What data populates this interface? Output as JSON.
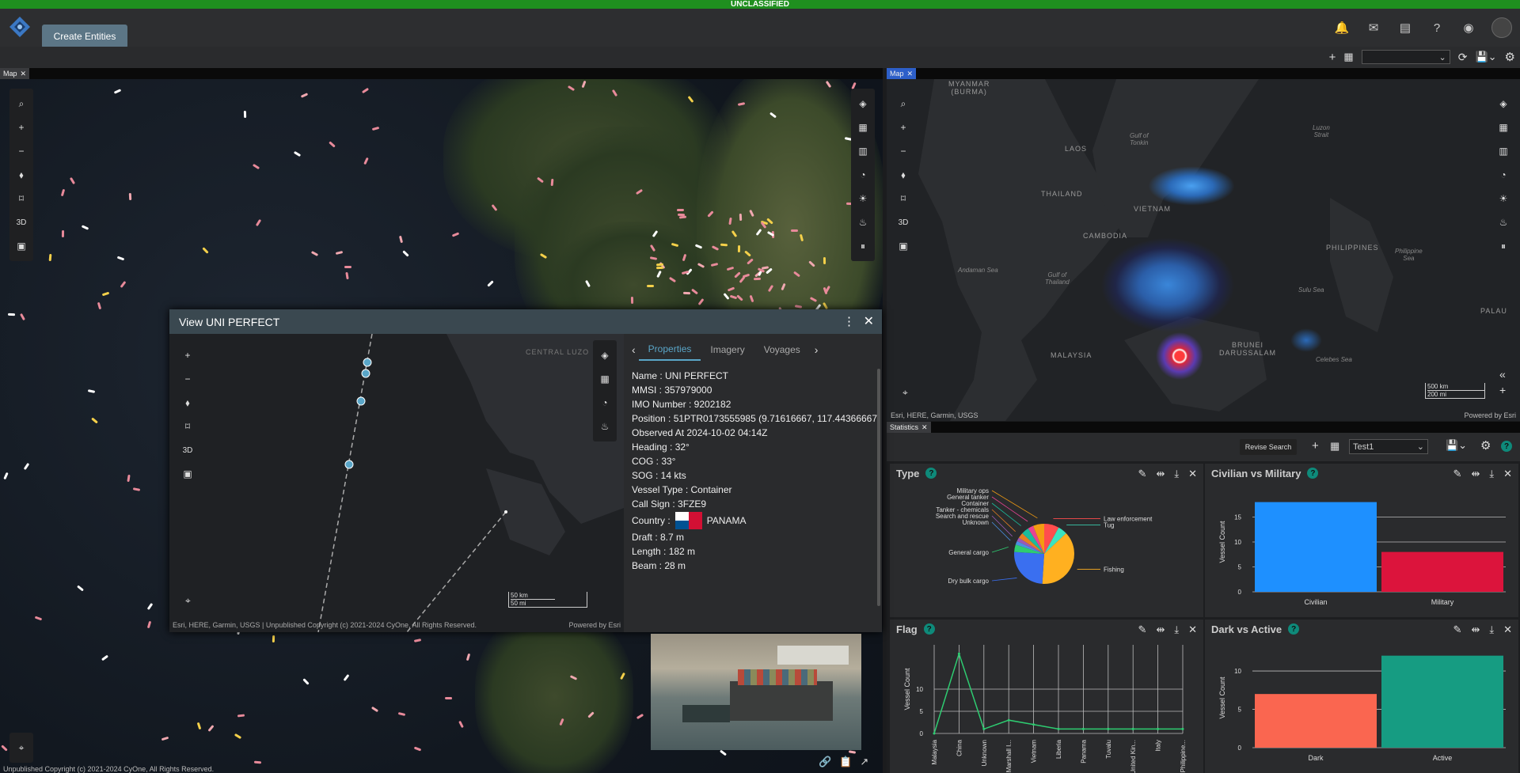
{
  "classification": "UNCLASSIFIED",
  "header": {
    "create_button": "Create Entities"
  },
  "left_map": {
    "tab": "Map",
    "tool_3d": "3D",
    "copyright": "Unpublished Copyright (c) 2021-2024 CyOne, All Rights Reserved."
  },
  "right_map": {
    "tab": "Map",
    "tool_3d": "3D",
    "attribution": "Esri, HERE, Garmin, USGS",
    "powered": "Powered by Esri",
    "scale_km": "500 km",
    "scale_mi": "200 mi",
    "labels": {
      "myanmar": "MYANMAR\n(BURMA)",
      "laos": "LAOS",
      "thailand": "THAILAND",
      "vietnam": "VIETNAM",
      "cambodia": "CAMBODIA",
      "malaysia": "MALAYSIA",
      "brunei": "BRUNEI\nDARUSSALAM",
      "philippines": "PHILIPPINES",
      "palau": "PALAU",
      "andaman": "Andaman Sea",
      "gulf_thailand": "Gulf of\nThailand",
      "gulf_tonkin": "Gulf of\nTonkin",
      "luzon": "Luzon\nStrait",
      "sulu": "Sulu Sea",
      "celebes": "Celebes Sea",
      "phil_sea": "Philippine\nSea"
    }
  },
  "dialog": {
    "title": "View UNI PERFECT",
    "tool_3d": "3D",
    "map_label": "CENTRAL LUZO",
    "scale_km": "50 km",
    "scale_mi": "50 mi",
    "attribution": "Esri, HERE, Garmin, USGS | Unpublished Copyright (c) 2021-2024 CyOne, All Rights Reserved.",
    "powered": "Powered by Esri",
    "tabs": [
      "Properties",
      "Imagery",
      "Voyages"
    ],
    "props": {
      "name": "Name : UNI PERFECT",
      "mmsi": "MMSI : 357979000",
      "imo": "IMO Number : 9202182",
      "position": "Position : 51PTR0173555985 (9.71616667, 117.44366667)",
      "observed": "Observed At 2024-10-02 04:14Z",
      "heading": "Heading : 32°",
      "cog": "COG : 33°",
      "sog": "SOG : 14 kts",
      "vessel_type": "Vessel Type : Container",
      "call_sign": "Call Sign : 3FZE9",
      "country_label": "Country :",
      "country": "PANAMA",
      "draft": "Draft : 8.7 m",
      "length": "Length : 182 m",
      "beam": "Beam : 28 m"
    }
  },
  "statistics": {
    "tab": "Statistics",
    "revise": "Revise Search",
    "preset": "Test1"
  },
  "type_widget": {
    "title": "Type",
    "help": "?"
  },
  "civmil_widget": {
    "title": "Civilian vs Military",
    "help": "?"
  },
  "flag_widget": {
    "title": "Flag",
    "help": "?"
  },
  "dark_widget": {
    "title": "Dark vs Active",
    "help": "?"
  },
  "chart_data": [
    {
      "type": "pie",
      "title": "Type",
      "categories": [
        "Law enforcement",
        "Tug",
        "Fishing",
        "Dry bulk cargo",
        "General cargo",
        "Unknown",
        "Search and rescue",
        "Tanker - chemicals",
        "Container",
        "General tanker",
        "Military ops"
      ],
      "values": [
        8,
        5,
        38,
        25,
        4,
        2,
        2,
        3,
        4,
        3,
        6
      ]
    },
    {
      "type": "bar",
      "title": "Civilian vs Military",
      "categories": [
        "Civilian",
        "Military"
      ],
      "values": [
        18,
        8
      ],
      "ylabel": "Vessel Count",
      "ylim": [
        0,
        20
      ],
      "yticks": [
        0,
        5,
        10,
        15
      ],
      "colors": [
        "#1e90ff",
        "#dc143c"
      ]
    },
    {
      "type": "line",
      "title": "Flag",
      "categories": [
        "Malaysia",
        "China",
        "Unknown",
        "Marshall I...",
        "Vietnam",
        "Liberia",
        "Panama",
        "Tuvalu",
        "United Kin...",
        "Italy",
        "Philippine..."
      ],
      "values": [
        0,
        18,
        1,
        3,
        2,
        1,
        1,
        1,
        1,
        1,
        1
      ],
      "ylabel": "Vessel Count",
      "ylim": [
        0,
        20
      ],
      "yticks": [
        0,
        5,
        10
      ]
    },
    {
      "type": "bar",
      "title": "Dark vs Active",
      "categories": [
        "Dark",
        "Active"
      ],
      "values": [
        7,
        12
      ],
      "ylabel": "Vessel Count",
      "ylim": [
        0,
        13
      ],
      "yticks": [
        0,
        5,
        10
      ],
      "colors": [
        "#fa6650",
        "#169c82"
      ]
    }
  ]
}
